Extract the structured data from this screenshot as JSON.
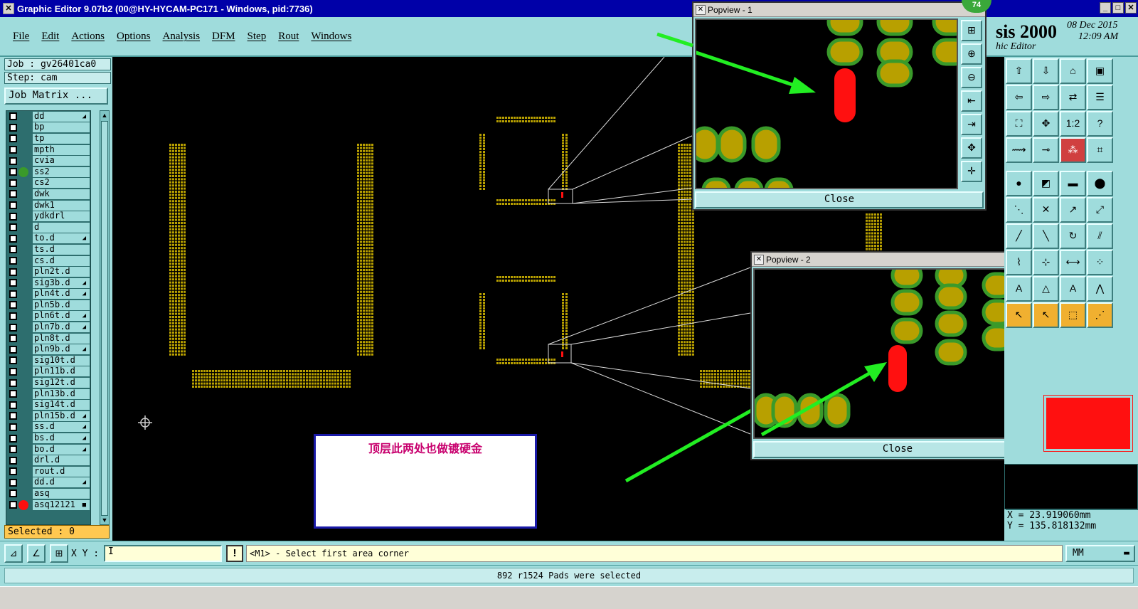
{
  "window": {
    "title": "Graphic Editor 9.07b2 (00@HY-HYCAM-PC171 - Windows, pid:7736)",
    "brand": "sis 2000",
    "brand_sub": "hic Editor",
    "date": "08 Dec 2015",
    "time": "12:09 AM",
    "badge": "74"
  },
  "menu": [
    "File",
    "Edit",
    "Actions",
    "Options",
    "Analysis",
    "DFM",
    "Step",
    "Rout",
    "Windows"
  ],
  "job": {
    "job_label": "Job : gv26401ca0",
    "step_label": "Step: cam",
    "matrix_button": "Job Matrix ..."
  },
  "layers": [
    {
      "name": "dd",
      "mark": "◢",
      "dot": ""
    },
    {
      "name": "bp",
      "mark": "",
      "dot": ""
    },
    {
      "name": "tp",
      "mark": "",
      "dot": ""
    },
    {
      "name": "mpth",
      "mark": "",
      "dot": ""
    },
    {
      "name": "cvia",
      "mark": "",
      "dot": ""
    },
    {
      "name": "ss2",
      "mark": "",
      "dot": "#3a9a2a"
    },
    {
      "name": "cs2",
      "mark": "",
      "dot": ""
    },
    {
      "name": "dwk",
      "mark": "",
      "dot": ""
    },
    {
      "name": "dwk1",
      "mark": "",
      "dot": ""
    },
    {
      "name": "ydkdrl",
      "mark": "",
      "dot": ""
    },
    {
      "name": "d",
      "mark": "",
      "dot": ""
    },
    {
      "name": "to.d",
      "mark": "◢",
      "dot": ""
    },
    {
      "name": "ts.d",
      "mark": "",
      "dot": ""
    },
    {
      "name": "cs.d",
      "mark": "",
      "dot": ""
    },
    {
      "name": "pln2t.d",
      "mark": "",
      "dot": ""
    },
    {
      "name": "sig3b.d",
      "mark": "◢",
      "dot": ""
    },
    {
      "name": "pln4t.d",
      "mark": "◢",
      "dot": ""
    },
    {
      "name": "pln5b.d",
      "mark": "",
      "dot": ""
    },
    {
      "name": "pln6t.d",
      "mark": "◢",
      "dot": ""
    },
    {
      "name": "pln7b.d",
      "mark": "◢",
      "dot": ""
    },
    {
      "name": "pln8t.d",
      "mark": "",
      "dot": ""
    },
    {
      "name": "pln9b.d",
      "mark": "◢",
      "dot": ""
    },
    {
      "name": "sig10t.d",
      "mark": "",
      "dot": ""
    },
    {
      "name": "pln11b.d",
      "mark": "",
      "dot": ""
    },
    {
      "name": "sig12t.d",
      "mark": "",
      "dot": ""
    },
    {
      "name": "pln13b.d",
      "mark": "",
      "dot": ""
    },
    {
      "name": "sig14t.d",
      "mark": "",
      "dot": ""
    },
    {
      "name": "pln15b.d",
      "mark": "◢",
      "dot": ""
    },
    {
      "name": "ss.d",
      "mark": "◢",
      "dot": ""
    },
    {
      "name": "bs.d",
      "mark": "◢",
      "dot": ""
    },
    {
      "name": "bo.d",
      "mark": "◢",
      "dot": ""
    },
    {
      "name": "drl.d",
      "mark": "",
      "dot": ""
    },
    {
      "name": "rout.d",
      "mark": "",
      "dot": ""
    },
    {
      "name": "dd.d",
      "mark": "◢",
      "dot": ""
    },
    {
      "name": "asq",
      "mark": "",
      "dot": ""
    },
    {
      "name": "asq12121",
      "mark": "■",
      "dot": "#ff1010"
    }
  ],
  "selected_label": "Selected : 0",
  "annotation": "顶层此两处也做镀硬金",
  "popview1": {
    "title": "Popview - 1",
    "close": "Close"
  },
  "popview2": {
    "title": "Popview - 2",
    "close": "Close"
  },
  "coords": {
    "x": "X = 23.919060mm",
    "y": "Y = 135.818132mm"
  },
  "xybar": {
    "label": "X Y :",
    "input_value": "I",
    "warn": "!",
    "prompt": "<M1> - Select first area corner",
    "units": "MM"
  },
  "status": "892 r1524 Pads were selected",
  "colors": {
    "panel": "#9fdcdc",
    "pad": "#b8a000",
    "pad_outline": "#3a9a2a",
    "selected_pad": "#ff1010",
    "arrow": "#22ee22"
  }
}
